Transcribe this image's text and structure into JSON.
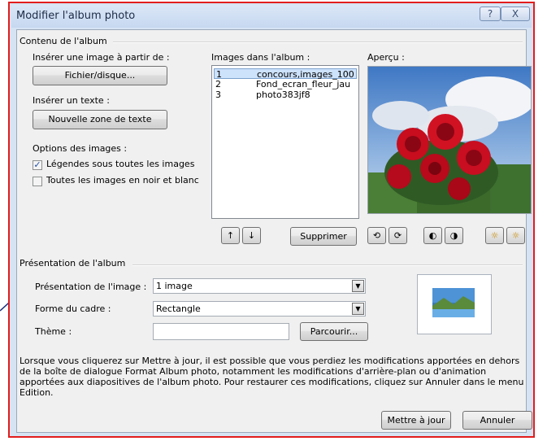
{
  "window": {
    "title": "Modifier l'album photo",
    "help_glyph": "?",
    "close_glyph": "X"
  },
  "content_group": {
    "title": "Contenu de l'album",
    "insert_image_label": "Insérer une image à partir de :",
    "file_button": "Fichier/disque...",
    "insert_text_label": "Insérer un texte :",
    "new_textbox_button": "Nouvelle zone de texte",
    "image_options_label": "Options des images :",
    "captions_checkbox": {
      "label": "Légendes sous toutes les images",
      "checked": true
    },
    "blackwhite_checkbox": {
      "label": "Toutes les images en noir et blanc",
      "checked": false
    }
  },
  "images_list": {
    "label": "Images dans l'album :",
    "items": [
      {
        "num": "1",
        "name": "concours,images_100",
        "selected": true
      },
      {
        "num": "2",
        "name": "Fond_ecran_fleur_jau",
        "selected": false
      },
      {
        "num": "3",
        "name": "photo383jf8",
        "selected": false
      }
    ],
    "move_up_glyph": "↑",
    "move_down_glyph": "↓",
    "remove_button": "Supprimer"
  },
  "preview": {
    "label": "Aperçu :"
  },
  "layout_group": {
    "title": "Présentation de l'album",
    "picture_layout_label": "Présentation de l'image :",
    "picture_layout_value": "1 image",
    "frame_shape_label": "Forme du cadre :",
    "frame_shape_value": "Rectangle",
    "theme_label": "Thème :",
    "theme_value": "",
    "browse_button": "Parcourir..."
  },
  "info_text": "Lorsque vous cliquerez sur Mettre à jour, il est possible que vous perdiez les modifications apportées en dehors de la boîte de dialogue Format Album photo, notamment les modifications d'arrière-plan ou d'animation apportées aux diapositives de l'album photo. Pour restaurer ces modifications, cliquez sur Annuler dans le menu Edition.",
  "footer": {
    "update_button": "Mettre à jour",
    "cancel_button": "Annuler"
  },
  "colors": {
    "annotation_red": "#e21d1d",
    "selection_blue": "#cde2fb"
  }
}
